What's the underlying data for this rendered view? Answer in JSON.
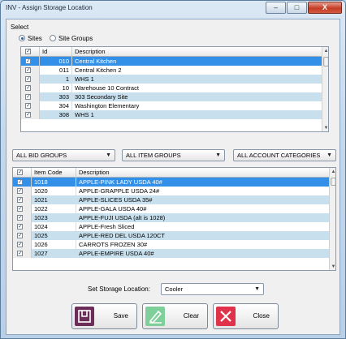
{
  "window": {
    "title": "INV - Assign Storage Location",
    "min": "–",
    "max": "□",
    "close": "X"
  },
  "select_label": "Select",
  "radios": [
    {
      "label": "Sites",
      "on": true
    },
    {
      "label": "Site Groups",
      "on": false
    }
  ],
  "sites": {
    "headers": [
      "Id",
      "Description"
    ],
    "rows": [
      {
        "checked": true,
        "id": "010",
        "desc": "Central Kitchen"
      },
      {
        "checked": true,
        "id": "011",
        "desc": "Central Kitchen 2"
      },
      {
        "checked": true,
        "id": "1",
        "desc": "WHS 1"
      },
      {
        "checked": true,
        "id": "10",
        "desc": "Warehouse 10 Contract"
      },
      {
        "checked": true,
        "id": "303",
        "desc": "303 Secondary Site"
      },
      {
        "checked": true,
        "id": "304",
        "desc": "Washington Elementary"
      },
      {
        "checked": true,
        "id": "308",
        "desc": "WHS 1"
      }
    ]
  },
  "filters": [
    "ALL BID GROUPS",
    "ALL ITEM GROUPS",
    "ALL ACCOUNT CATEGORIES"
  ],
  "items": {
    "headers": [
      "Item Code",
      "Description"
    ],
    "rows": [
      {
        "checked": true,
        "code": "1018",
        "desc": "APPLE-PINK LADY USDA 40#"
      },
      {
        "checked": true,
        "code": "1020",
        "desc": "APPLE-GRAPPLE     USDA 24#"
      },
      {
        "checked": true,
        "code": "1021",
        "desc": "APPLE-SLICES    USDA 35#"
      },
      {
        "checked": true,
        "code": "1022",
        "desc": "APPLE-GALA USDA 40#"
      },
      {
        "checked": true,
        "code": "1023",
        "desc": "APPLE-FUJI USDA (alt is 1028)"
      },
      {
        "checked": true,
        "code": "1024",
        "desc": "APPLE-Fresh Sliced"
      },
      {
        "checked": true,
        "code": "1025",
        "desc": "APPLE-RED DEL  USDA 120CT"
      },
      {
        "checked": true,
        "code": "1026",
        "desc": "CARROTS FROZEN 30#"
      },
      {
        "checked": true,
        "code": "1027",
        "desc": "APPLE-EMPIRE USDA 40#"
      }
    ]
  },
  "storage": {
    "label": "Set Storage Location:",
    "value": "Cooler"
  },
  "buttons": {
    "save": "Save",
    "clear": "Clear",
    "close": "Close"
  },
  "colors": {
    "selected_row": "#3390e8",
    "alt_row": "#c8e0ee",
    "save_icon": "#6b2e59",
    "clear_icon": "#7fcf9a",
    "close_icon": "#e0334b"
  },
  "check_glyph": "✓"
}
